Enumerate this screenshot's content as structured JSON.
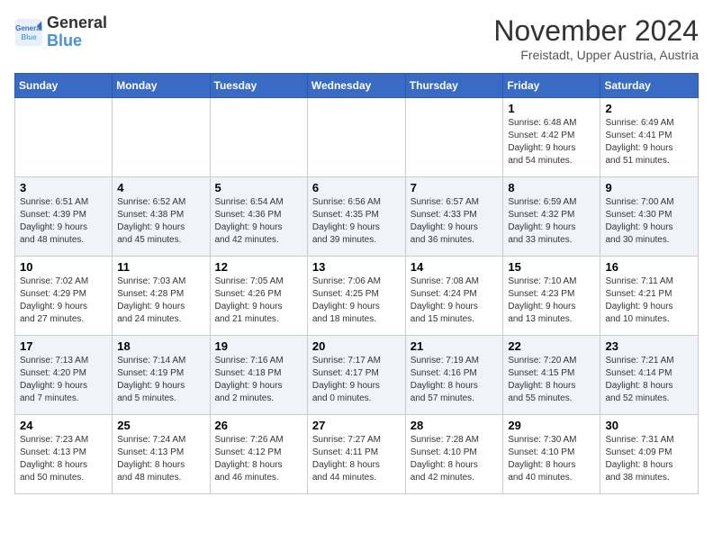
{
  "logo": {
    "line1": "General",
    "line2": "Blue"
  },
  "title": "November 2024",
  "subtitle": "Freistadt, Upper Austria, Austria",
  "days_of_week": [
    "Sunday",
    "Monday",
    "Tuesday",
    "Wednesday",
    "Thursday",
    "Friday",
    "Saturday"
  ],
  "weeks": [
    [
      {
        "day": "",
        "info": ""
      },
      {
        "day": "",
        "info": ""
      },
      {
        "day": "",
        "info": ""
      },
      {
        "day": "",
        "info": ""
      },
      {
        "day": "",
        "info": ""
      },
      {
        "day": "1",
        "info": "Sunrise: 6:48 AM\nSunset: 4:42 PM\nDaylight: 9 hours\nand 54 minutes."
      },
      {
        "day": "2",
        "info": "Sunrise: 6:49 AM\nSunset: 4:41 PM\nDaylight: 9 hours\nand 51 minutes."
      }
    ],
    [
      {
        "day": "3",
        "info": "Sunrise: 6:51 AM\nSunset: 4:39 PM\nDaylight: 9 hours\nand 48 minutes."
      },
      {
        "day": "4",
        "info": "Sunrise: 6:52 AM\nSunset: 4:38 PM\nDaylight: 9 hours\nand 45 minutes."
      },
      {
        "day": "5",
        "info": "Sunrise: 6:54 AM\nSunset: 4:36 PM\nDaylight: 9 hours\nand 42 minutes."
      },
      {
        "day": "6",
        "info": "Sunrise: 6:56 AM\nSunset: 4:35 PM\nDaylight: 9 hours\nand 39 minutes."
      },
      {
        "day": "7",
        "info": "Sunrise: 6:57 AM\nSunset: 4:33 PM\nDaylight: 9 hours\nand 36 minutes."
      },
      {
        "day": "8",
        "info": "Sunrise: 6:59 AM\nSunset: 4:32 PM\nDaylight: 9 hours\nand 33 minutes."
      },
      {
        "day": "9",
        "info": "Sunrise: 7:00 AM\nSunset: 4:30 PM\nDaylight: 9 hours\nand 30 minutes."
      }
    ],
    [
      {
        "day": "10",
        "info": "Sunrise: 7:02 AM\nSunset: 4:29 PM\nDaylight: 9 hours\nand 27 minutes."
      },
      {
        "day": "11",
        "info": "Sunrise: 7:03 AM\nSunset: 4:28 PM\nDaylight: 9 hours\nand 24 minutes."
      },
      {
        "day": "12",
        "info": "Sunrise: 7:05 AM\nSunset: 4:26 PM\nDaylight: 9 hours\nand 21 minutes."
      },
      {
        "day": "13",
        "info": "Sunrise: 7:06 AM\nSunset: 4:25 PM\nDaylight: 9 hours\nand 18 minutes."
      },
      {
        "day": "14",
        "info": "Sunrise: 7:08 AM\nSunset: 4:24 PM\nDaylight: 9 hours\nand 15 minutes."
      },
      {
        "day": "15",
        "info": "Sunrise: 7:10 AM\nSunset: 4:23 PM\nDaylight: 9 hours\nand 13 minutes."
      },
      {
        "day": "16",
        "info": "Sunrise: 7:11 AM\nSunset: 4:21 PM\nDaylight: 9 hours\nand 10 minutes."
      }
    ],
    [
      {
        "day": "17",
        "info": "Sunrise: 7:13 AM\nSunset: 4:20 PM\nDaylight: 9 hours\nand 7 minutes."
      },
      {
        "day": "18",
        "info": "Sunrise: 7:14 AM\nSunset: 4:19 PM\nDaylight: 9 hours\nand 5 minutes."
      },
      {
        "day": "19",
        "info": "Sunrise: 7:16 AM\nSunset: 4:18 PM\nDaylight: 9 hours\nand 2 minutes."
      },
      {
        "day": "20",
        "info": "Sunrise: 7:17 AM\nSunset: 4:17 PM\nDaylight: 9 hours\nand 0 minutes."
      },
      {
        "day": "21",
        "info": "Sunrise: 7:19 AM\nSunset: 4:16 PM\nDaylight: 8 hours\nand 57 minutes."
      },
      {
        "day": "22",
        "info": "Sunrise: 7:20 AM\nSunset: 4:15 PM\nDaylight: 8 hours\nand 55 minutes."
      },
      {
        "day": "23",
        "info": "Sunrise: 7:21 AM\nSunset: 4:14 PM\nDaylight: 8 hours\nand 52 minutes."
      }
    ],
    [
      {
        "day": "24",
        "info": "Sunrise: 7:23 AM\nSunset: 4:13 PM\nDaylight: 8 hours\nand 50 minutes."
      },
      {
        "day": "25",
        "info": "Sunrise: 7:24 AM\nSunset: 4:13 PM\nDaylight: 8 hours\nand 48 minutes."
      },
      {
        "day": "26",
        "info": "Sunrise: 7:26 AM\nSunset: 4:12 PM\nDaylight: 8 hours\nand 46 minutes."
      },
      {
        "day": "27",
        "info": "Sunrise: 7:27 AM\nSunset: 4:11 PM\nDaylight: 8 hours\nand 44 minutes."
      },
      {
        "day": "28",
        "info": "Sunrise: 7:28 AM\nSunset: 4:10 PM\nDaylight: 8 hours\nand 42 minutes."
      },
      {
        "day": "29",
        "info": "Sunrise: 7:30 AM\nSunset: 4:10 PM\nDaylight: 8 hours\nand 40 minutes."
      },
      {
        "day": "30",
        "info": "Sunrise: 7:31 AM\nSunset: 4:09 PM\nDaylight: 8 hours\nand 38 minutes."
      }
    ]
  ]
}
